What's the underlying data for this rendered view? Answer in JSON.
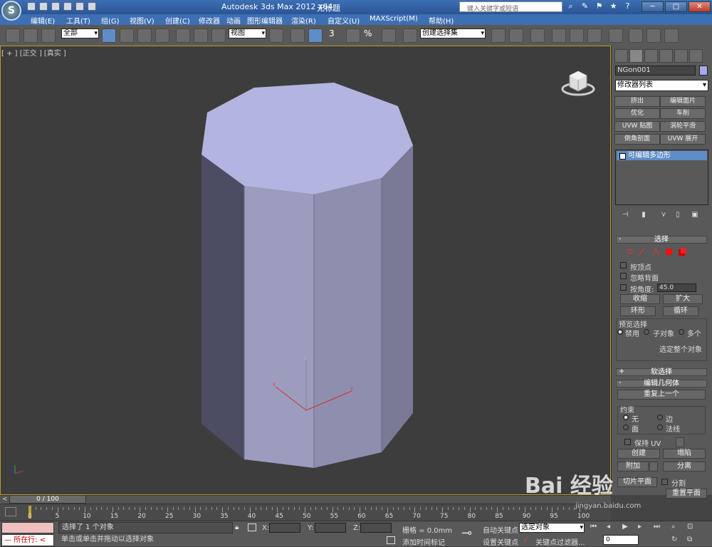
{
  "title": {
    "app": "Autodesk 3ds Max  2012 x64",
    "file": "无标题",
    "search_placeholder": "键入关键字或短语",
    "window_buttons": [
      "─",
      "□",
      "✕"
    ],
    "help_icon": "?"
  },
  "menu": [
    "编辑(E)",
    "工具(T)",
    "组(G)",
    "视图(V)",
    "创建(C)",
    "修改器",
    "动画",
    "图形编辑器",
    "渲染(R)",
    "自定义(U)",
    "MAXScript(M)",
    "帮助(H)"
  ],
  "toolbar": {
    "selection_filter": "全部",
    "ref_coord": "视图",
    "snap_angle": "3",
    "percent_snap": "%",
    "named_selection": "创建选择集"
  },
  "viewport": {
    "label_parts": [
      "[ + ]",
      "[正交 ]",
      "[真实 ]"
    ],
    "object_color": "#b4b4e0",
    "border_color": "#b89a2a",
    "gizmo_labels": {
      "x": "x",
      "y": "y",
      "z": "z"
    }
  },
  "command_panel": {
    "object_name": "NGon001",
    "object_color": "#a8a8ea",
    "modifier_list": "修改器列表",
    "modifier_buttons": [
      [
        "挤出",
        "编辑面片"
      ],
      [
        "优化",
        "车削"
      ],
      [
        "UVW 贴图",
        "涡轮平滑"
      ],
      [
        "倒角剖面",
        "UVW 展开"
      ]
    ],
    "stack_item": "可编辑多边形",
    "selection_rollout": {
      "title": "选择",
      "by_vertex": "按顶点",
      "ignore_backfacing": "忽略背面",
      "by_angle": "按角度:",
      "angle_value": "45.0",
      "shrink": "收缩",
      "grow": "扩大",
      "ring": "环形",
      "loop": "循环",
      "preview_title": "预览选择",
      "preview_options": [
        "禁用",
        "子对象",
        "多个"
      ],
      "selected_summary": "选定整个对象"
    },
    "soft_selection_title": "软选择",
    "edit_geometry": {
      "title": "编辑几何体",
      "repeat_last": "重复上一个",
      "constraints_title": "约束",
      "constraints": [
        "无",
        "边",
        "面",
        "法线"
      ],
      "preserve_uv": "保持 UV",
      "create": "创建",
      "collapse": "塌陷",
      "attach": "附加",
      "detach": "分离",
      "slice_plane": "切片平面",
      "split": "分割",
      "reset_plane": "重置平面",
      "cut": "切割"
    }
  },
  "timeline": {
    "frame_label": "0 / 100",
    "left_arrow": "<",
    "right_arrow": ">",
    "ticks": [
      "0",
      "5",
      "10",
      "15",
      "20",
      "25",
      "30",
      "35",
      "40",
      "45",
      "50",
      "55",
      "60",
      "65",
      "70",
      "75",
      "80",
      "85",
      "90",
      "95",
      "100"
    ]
  },
  "status": {
    "maxscript_label": "所在行:",
    "selected_text": "选择了 1 个对象",
    "prompt_text": "单击或单击并拖动以选择对象",
    "x_label": "X:",
    "y_label": "Y:",
    "z_label": "Z:",
    "grid": "栅格 = 0.0mm",
    "add_time_tag": "添加时间标记",
    "auto_key": "自动关键点",
    "set_key": "设置关键点",
    "selected_dropdown": "选定对象",
    "key_filters": "关键点过滤器...",
    "frame_value": "0"
  },
  "watermark": {
    "brand": "Bai  经验",
    "url": "jingyan.baidu.com"
  }
}
